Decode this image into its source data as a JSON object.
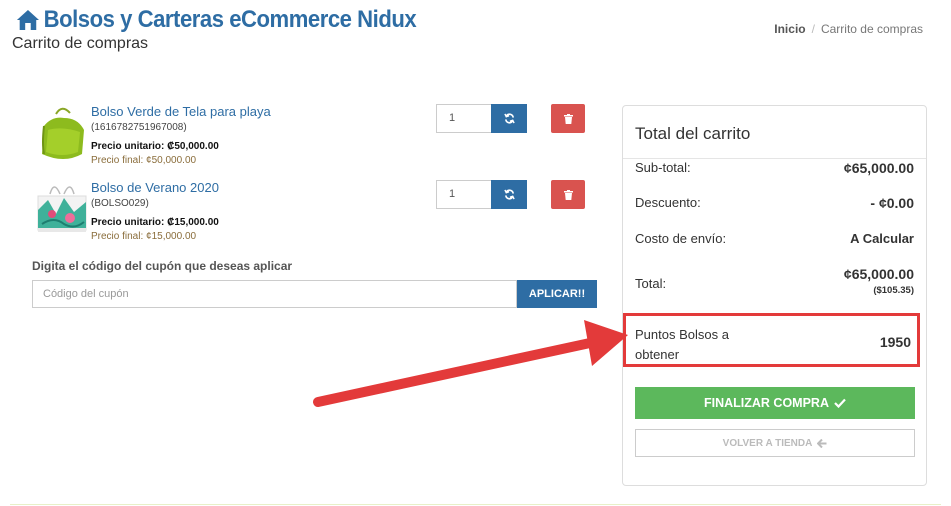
{
  "header": {
    "site_title": "Bolsos y Carteras eCommerce Nidux",
    "page_subtitle": "Carrito de compras"
  },
  "breadcrumb": {
    "home": "Inicio",
    "separator": "/",
    "current": "Carrito de compras"
  },
  "cart_items": [
    {
      "name": "Bolso Verde de Tela para playa",
      "code": "(1616782751967008)",
      "unit_price": "Precio unitario: ₡50,000.00",
      "final_price": "Precio final: ¢50,000.00",
      "quantity": "1"
    },
    {
      "name": "Bolso de Verano 2020",
      "code": "(BOLSO029)",
      "unit_price": "Precio unitario: ₡15,000.00",
      "final_price": "Precio final: ¢15,000.00",
      "quantity": "1"
    }
  ],
  "coupon": {
    "label": "Digita el código del cupón que deseas aplicar",
    "placeholder": "Código del cupón",
    "apply_label": "APLICAR!!"
  },
  "summary": {
    "title": "Total del carrito",
    "subtotal_label": "Sub-total:",
    "subtotal_value": "¢65,000.00",
    "discount_label": "Descuento:",
    "discount_value": "- ¢0.00",
    "shipping_label": "Costo de envío:",
    "shipping_value": "A Calcular",
    "total_label": "Total:",
    "total_value": "¢65,000.00",
    "total_usd": "($105.35)",
    "points_label": "Puntos Bolsos a obtener",
    "points_value": "1950",
    "finalize_label": "FINALIZAR COMPRA",
    "back_label": "VOLVER A TIENDA"
  },
  "colors": {
    "brand_blue": "#2e6da4",
    "delete_red": "#d9534f",
    "finalize_green": "#5cb85c",
    "highlight_red": "#e33a3a"
  },
  "icons": {
    "home": "home-icon",
    "refresh": "refresh-icon",
    "delete": "trash-icon",
    "check": "check-icon",
    "back": "arrow-left-icon"
  }
}
